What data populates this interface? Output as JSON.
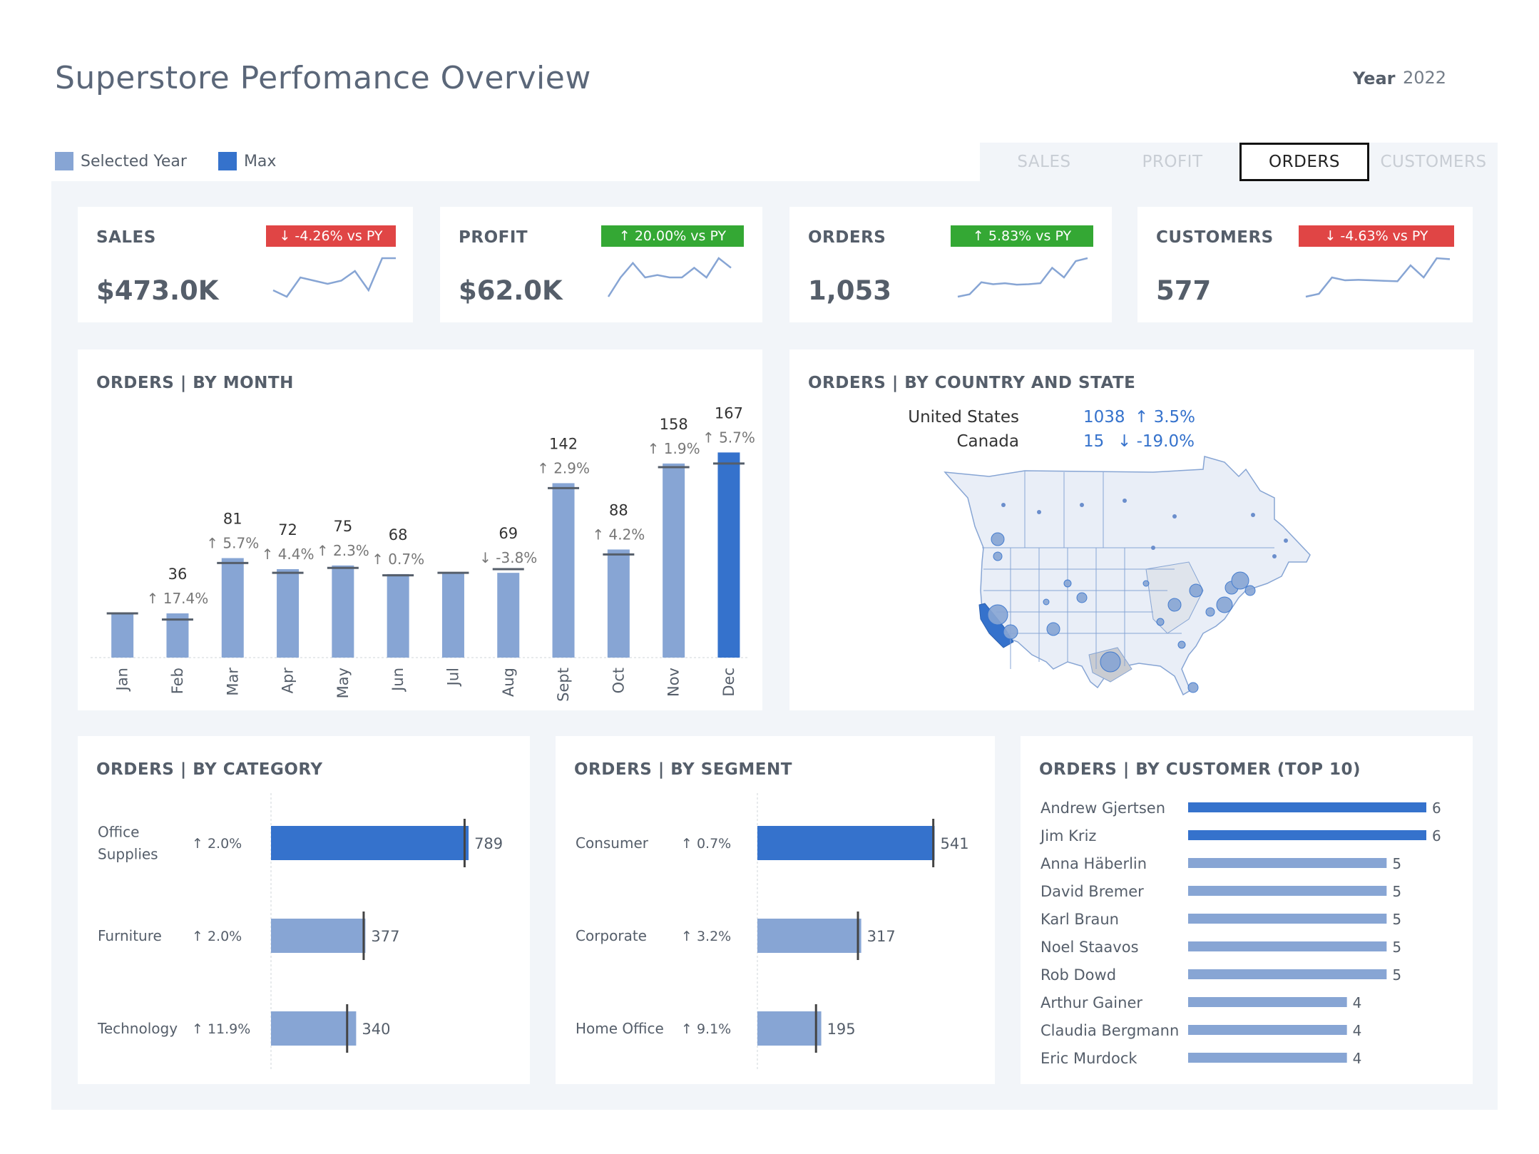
{
  "title": "Superstore Perfomance Overview",
  "year": {
    "label": "Year",
    "value": "2022"
  },
  "legend": {
    "selected_year": "Selected Year",
    "max": "Max"
  },
  "colors": {
    "selected": "#87a5d4",
    "max": "#3572cc",
    "down": "#e04545",
    "up": "#34a834"
  },
  "tabs": [
    {
      "label": "SALES",
      "active": false
    },
    {
      "label": "PROFIT",
      "active": false
    },
    {
      "label": "ORDERS",
      "active": true
    },
    {
      "label": "CUSTOMERS",
      "active": false
    }
  ],
  "kpis": [
    {
      "label": "SALES",
      "value": "$473.0K",
      "badge": "↓ -4.26% vs PY",
      "trend": "down",
      "spark": [
        4,
        3,
        6,
        5.5,
        5,
        5.5,
        7,
        4,
        9,
        9
      ]
    },
    {
      "label": "PROFIT",
      "value": "$62.0K",
      "badge": "↑ 20.00% vs PY",
      "trend": "up",
      "spark": [
        2,
        6,
        9,
        6,
        6.5,
        6,
        6,
        8,
        6,
        10,
        8
      ]
    },
    {
      "label": "ORDERS",
      "value": "1,053",
      "badge": "↑ 5.83% vs PY",
      "trend": "up",
      "spark": [
        2,
        2.5,
        5,
        4.6,
        4.8,
        4.5,
        4.6,
        4.8,
        8,
        6,
        9.4,
        10
      ]
    },
    {
      "label": "CUSTOMERS",
      "value": "577",
      "badge": "↓ -4.63% vs PY",
      "trend": "down",
      "spark": [
        2,
        2.6,
        6,
        5.4,
        5.5,
        5.4,
        5.3,
        5.2,
        8.5,
        6,
        10,
        9.8
      ]
    }
  ],
  "by_month": {
    "title": "ORDERS | BY MONTH",
    "chart_data": {
      "type": "bar",
      "categories": [
        "Jan",
        "Feb",
        "Mar",
        "Apr",
        "May",
        "Jun",
        "Jul",
        "Aug",
        "Sept",
        "Oct",
        "Nov",
        "Dec"
      ],
      "values": [
        36,
        36,
        81,
        72,
        75,
        68,
        69,
        69,
        142,
        88,
        158,
        167
      ],
      "value_labels": [
        "",
        "36",
        "81",
        "72",
        "75",
        "68",
        "",
        "69",
        "142",
        "88",
        "158",
        "167"
      ],
      "pct_labels": [
        "",
        "↑ 17.4%",
        "↑ 5.7%",
        "↑ 4.4%",
        "↑ 2.3%",
        "↑ 0.7%",
        "",
        "↓ -3.8%",
        "↑ 2.9%",
        "↑ 4.2%",
        "↑ 1.9%",
        "↑ 5.7%"
      ],
      "prior_year": [
        36,
        31,
        77,
        69,
        73,
        67,
        69,
        72,
        138,
        84,
        155,
        158
      ],
      "max_index": 11,
      "ylim": [
        0,
        180
      ]
    }
  },
  "by_state": {
    "title": "ORDERS | BY COUNTRY AND STATE",
    "rows": [
      {
        "country": "United States",
        "value": "1038",
        "change": "↑ 3.5%"
      },
      {
        "country": "Canada",
        "value": "15",
        "change": "↓ -19.0%"
      }
    ]
  },
  "by_category": {
    "title": "ORDERS | BY CATEGORY",
    "chart_data": {
      "type": "bar",
      "orientation": "horizontal",
      "categories": [
        "Office Supplies",
        "Furniture",
        "Technology"
      ],
      "category_lines": [
        [
          "Office",
          "Supplies"
        ],
        [
          "Furniture"
        ],
        [
          "Technology"
        ]
      ],
      "pct_labels": [
        "↑   2.0%",
        "↑   2.0%",
        "↑   11.9%"
      ],
      "values": [
        789,
        377,
        340
      ],
      "prior_year": [
        773,
        370,
        304
      ],
      "max_index": 0,
      "xlim": [
        0,
        860
      ]
    }
  },
  "by_segment": {
    "title": "ORDERS | BY SEGMENT",
    "chart_data": {
      "type": "bar",
      "orientation": "horizontal",
      "categories": [
        "Consumer",
        "Corporate",
        "Home Office"
      ],
      "pct_labels": [
        "↑   0.7%",
        "↑   3.2%",
        "↑   9.1%"
      ],
      "values": [
        541,
        317,
        195
      ],
      "prior_year": [
        537,
        307,
        179
      ],
      "max_index": 0,
      "xlim": [
        0,
        590
      ]
    }
  },
  "by_customer": {
    "title": "ORDERS | BY CUSTOMER (TOP 10)",
    "chart_data": {
      "type": "bar",
      "orientation": "horizontal",
      "categories": [
        "Andrew Gjertsen",
        "Jim Kriz",
        "Anna Häberlin",
        "David Bremer",
        "Karl Braun",
        "Noel Staavos",
        "Rob Dowd",
        "Arthur Gainer",
        "Claudia Bergmann",
        "Eric Murdock"
      ],
      "values": [
        6,
        6,
        5,
        5,
        5,
        5,
        5,
        4,
        4,
        4
      ],
      "max_value": 6,
      "xlim": [
        0,
        6
      ]
    }
  }
}
